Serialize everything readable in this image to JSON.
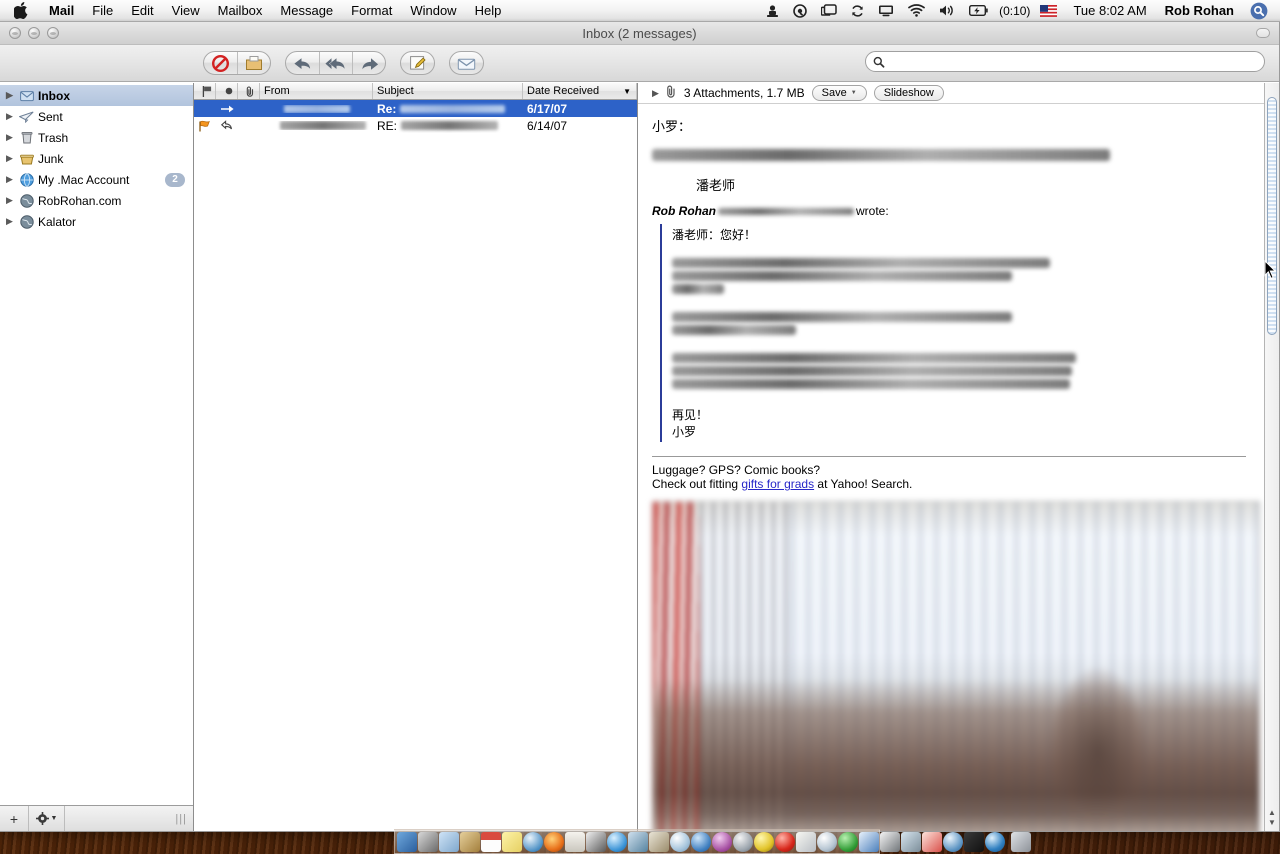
{
  "menubar": {
    "apple_icon": "apple-logo-icon",
    "app_name": "Mail",
    "items": [
      "File",
      "Edit",
      "View",
      "Mailbox",
      "Message",
      "Format",
      "Window",
      "Help"
    ],
    "status_icons": [
      "vpn-icon",
      "quicktime-icon",
      "displays-icon",
      "sync-icon",
      "remote-desktop-icon",
      "wifi-icon",
      "volume-icon",
      "battery-icon"
    ],
    "battery_time": "(0:10)",
    "flag_icon": "us-flag-icon",
    "clock": "Tue 8:02 AM",
    "user": "Rob Rohan",
    "spotlight_icon": "spotlight-search-icon"
  },
  "window": {
    "title": "Inbox (2 messages)",
    "close_label": "Close",
    "minimize_label": "Minimize",
    "zoom_label": "Zoom"
  },
  "toolbar": {
    "buttons": [
      {
        "name": "junk-button",
        "icon": "no-entry-icon",
        "label": "Junk"
      },
      {
        "name": "delete-button",
        "icon": "delete-box-icon",
        "label": "Delete"
      },
      {
        "name": "reply-button",
        "icon": "reply-arrow-icon",
        "label": "Reply"
      },
      {
        "name": "reply-all-button",
        "icon": "reply-all-arrow-icon",
        "label": "Reply All"
      },
      {
        "name": "forward-button",
        "icon": "forward-arrow-icon",
        "label": "Forward"
      },
      {
        "name": "compose-button",
        "icon": "compose-pencil-icon",
        "label": "New Message"
      },
      {
        "name": "get-mail-button",
        "icon": "envelope-icon",
        "label": "Get Mail"
      }
    ]
  },
  "search": {
    "placeholder": "",
    "value": "",
    "icon": "search-magnifier-icon"
  },
  "sidebar": {
    "items": [
      {
        "label": "Inbox",
        "icon": "inbox-tray-icon",
        "selected": true,
        "badge": ""
      },
      {
        "label": "Sent",
        "icon": "sent-paperplane-icon",
        "selected": false,
        "badge": ""
      },
      {
        "label": "Trash",
        "icon": "trash-can-icon",
        "selected": false,
        "badge": ""
      },
      {
        "label": "Junk",
        "icon": "junk-basket-icon",
        "selected": false,
        "badge": ""
      },
      {
        "label": "My .Mac Account",
        "icon": "dotmac-globe-icon",
        "selected": false,
        "badge": "2"
      },
      {
        "label": "RobRohan.com",
        "icon": "account-globe-icon",
        "selected": false,
        "badge": ""
      },
      {
        "label": "Kalator",
        "icon": "account-globe-icon",
        "selected": false,
        "badge": ""
      }
    ],
    "footer": {
      "add_label": "+",
      "add_icon": "plus-icon",
      "action_icon": "gear-icon",
      "resize_icon": "resize-grip-icon"
    }
  },
  "message_list": {
    "columns": [
      {
        "key": "flag",
        "label": "",
        "icon": "flag-column-icon"
      },
      {
        "key": "unread",
        "label": "",
        "icon": "unread-dot-column-icon"
      },
      {
        "key": "attach",
        "label": "",
        "icon": "attachment-column-icon"
      },
      {
        "key": "from",
        "label": "From"
      },
      {
        "key": "subject",
        "label": "Subject"
      },
      {
        "key": "date",
        "label": "Date Received",
        "sorted": "descending"
      }
    ],
    "rows": [
      {
        "selected": true,
        "flag_icon": "",
        "status_icon": "forwarded-arrow-icon",
        "attach_icon": "",
        "from": "",
        "from_redacted": true,
        "subject_prefix": "Re:",
        "subject_redacted": true,
        "date": "6/17/07"
      },
      {
        "selected": false,
        "flag_icon": "orange-flag-icon",
        "status_icon": "replied-arrow-icon",
        "attach_icon": "",
        "from": "",
        "from_redacted": true,
        "subject_prefix": "RE:",
        "subject_redacted": true,
        "date": "6/14/07"
      }
    ]
  },
  "reader": {
    "attachments": {
      "disclosure_icon": "disclosure-triangle-icon",
      "paperclip_icon": "paperclip-icon",
      "summary": "3 Attachments, 1.7 MB",
      "save_label": "Save",
      "save_menu_icon": "chevron-down-icon",
      "slideshow_label": "Slideshow"
    },
    "body": {
      "greeting": "小罗：",
      "signoff_name": "潘老师",
      "wrote_author": "Rob Rohan",
      "wrote_suffix": "wrote:",
      "quote_greeting": "潘老师：您好！",
      "quote_close_1": "再见！",
      "quote_close_2": "小罗"
    },
    "signature": {
      "line1": "Luggage? GPS? Comic books?",
      "line2_prefix": "Check out fitting ",
      "link": "gifts for grads",
      "line2_suffix": " at Yahoo! Search."
    },
    "photo_alt": "blurred-photo-attachment"
  },
  "scrollbar": {
    "up_icon": "scroll-up-arrow-icon",
    "down_icon": "scroll-down-arrow-icon"
  },
  "dock": {
    "items": [
      "finder-icon",
      "system-prefs-icon",
      "preview-icon",
      "package-icon",
      "ical-icon",
      "stickies-icon",
      "safari-icon",
      "firefox-icon",
      "terminal-icon",
      "ink-pen-icon",
      "itunes-icon",
      "transmit-icon",
      "address-book-icon",
      "sherlock-icon",
      "world-globe-icon",
      "photo-booth-icon",
      "dvd-player-icon",
      "flash-icon",
      "acrobat-icon",
      "textedit-icon",
      "disc-burner-icon",
      "xcode-icon",
      "sketchup-icon",
      "ink-tablet-icon",
      "screen-icon",
      "colorsync-icon",
      "quicktime-icon",
      "display-icon",
      "google-earth-icon"
    ],
    "trash_icon": "trash-icon"
  },
  "colors": {
    "selection_blue": "#2d62c8",
    "quote_border": "#2b3c99",
    "link": "#2727c8",
    "badge_bg": "#a8b7cc",
    "flag_orange": "#f08a1e",
    "junk_red": "#d32222"
  }
}
